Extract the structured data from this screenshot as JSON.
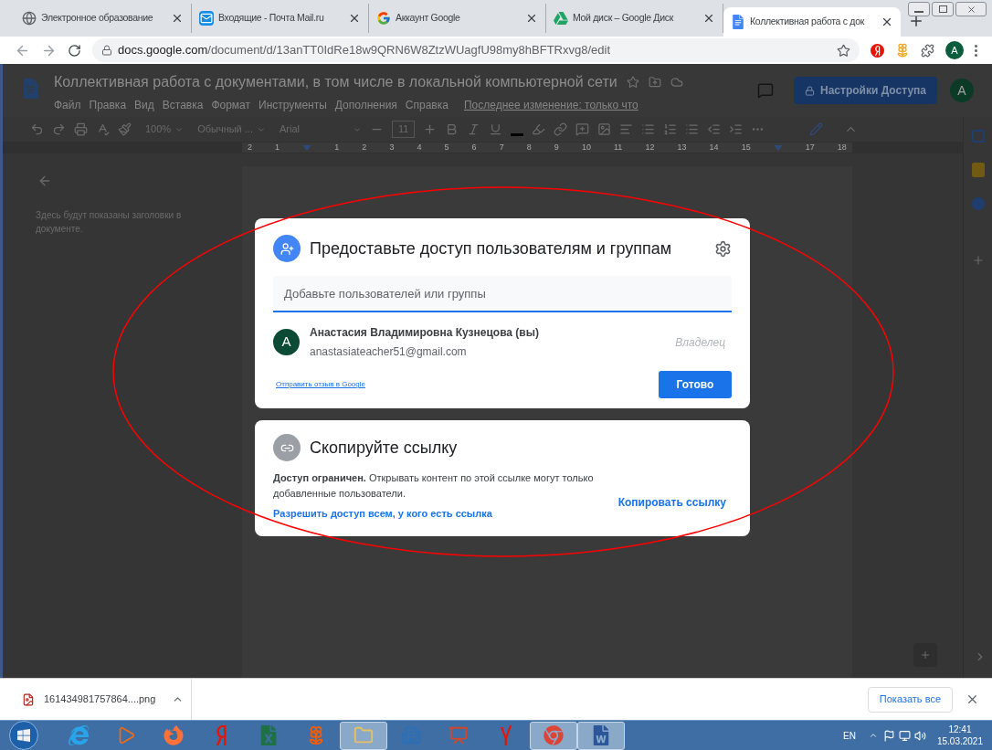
{
  "browser": {
    "tabs": [
      {
        "kind": "globe",
        "title": "Электронное образование",
        "selected": false
      },
      {
        "kind": "mail",
        "title": "Входящие - Почта Mail.ru",
        "selected": false
      },
      {
        "kind": "google",
        "title": "Аккаунт Google",
        "selected": false
      },
      {
        "kind": "drive",
        "title": "Мой диск – Google Диск",
        "selected": false
      },
      {
        "kind": "docs",
        "title": "Коллективная работа с док",
        "selected": true
      }
    ],
    "url_host": "docs.google.com",
    "url_path": "/document/d/13anTT0IdRe18w9QRN6W8ZtzWUagfU98my8hBFTRxvg8/edit",
    "profile": "A"
  },
  "docs": {
    "title": "Коллективная работа с документами,  в том числе в локальной компьютерной сети",
    "menu": [
      "Файл",
      "Правка",
      "Вид",
      "Вставка",
      "Формат",
      "Инструменты",
      "Дополнения",
      "Справка"
    ],
    "last_edit": "Последнее изменение: только что",
    "share_button": "Настройки Доступа",
    "avatar": "A",
    "toolbar": {
      "zoom": "100%",
      "style": "Обычный ...",
      "font": "Arial",
      "font_size": "11"
    },
    "ruler": [
      {
        "kind": "number",
        "label": "2"
      },
      {
        "kind": "number",
        "label": "1"
      },
      {
        "kind": "indent"
      },
      {
        "kind": "number",
        "label": "1"
      },
      {
        "kind": "number",
        "label": "2"
      },
      {
        "kind": "number",
        "label": "3"
      },
      {
        "kind": "number",
        "label": "4"
      },
      {
        "kind": "number",
        "label": "5"
      },
      {
        "kind": "number",
        "label": "6"
      },
      {
        "kind": "number",
        "label": "7"
      },
      {
        "kind": "number",
        "label": "8"
      },
      {
        "kind": "number",
        "label": "9"
      },
      {
        "kind": "number",
        "label": "10"
      },
      {
        "kind": "number",
        "label": "11"
      },
      {
        "kind": "number",
        "label": "12"
      },
      {
        "kind": "number",
        "label": "13"
      },
      {
        "kind": "number",
        "label": "14"
      },
      {
        "kind": "number",
        "label": "15"
      },
      {
        "kind": "indent"
      },
      {
        "kind": "number",
        "label": "17"
      },
      {
        "kind": "number",
        "label": "18"
      }
    ],
    "outline_hint": "Здесь будут показаны заголовки в документе."
  },
  "share_dialog": {
    "title": "Предоставьте доступ пользователям и группам",
    "placeholder": "Добавьте пользователей или группы",
    "user": {
      "initial": "A",
      "name": "Анастасия Владимировна Кузнецова (вы)",
      "email": "anastasiateacher51@gmail.com",
      "role": "Владелец"
    },
    "feedback_link": "Отправить отзыв в Google",
    "done_button": "Готово"
  },
  "link_dialog": {
    "title": "Скопируйте ссылку",
    "text": "**Доступ ограничен.** Открывать контент по этой ссылке могут только добавленные пользователи.",
    "change_link": "Разрешить доступ всем, у кого есть ссылка",
    "copy_button": "Копировать ссылку"
  },
  "download_bar": {
    "file": "161434981757864....png",
    "show_all": "Показать все"
  },
  "taskbar": {
    "apps": [
      {
        "kind": "ie",
        "active": false
      },
      {
        "kind": "media",
        "active": false
      },
      {
        "kind": "firefox",
        "active": false
      },
      {
        "kind": "yandex",
        "active": false
      },
      {
        "kind": "excel",
        "active": false
      },
      {
        "kind": "flower",
        "active": false
      },
      {
        "kind": "folder",
        "active": true
      },
      {
        "kind": "building",
        "active": false
      },
      {
        "kind": "slides",
        "active": false
      },
      {
        "kind": "ybrowser",
        "active": false
      },
      {
        "kind": "chrome",
        "active": true
      },
      {
        "kind": "word",
        "active": true
      }
    ],
    "language": "EN",
    "time": "12:41",
    "date": "15.03.2021"
  }
}
